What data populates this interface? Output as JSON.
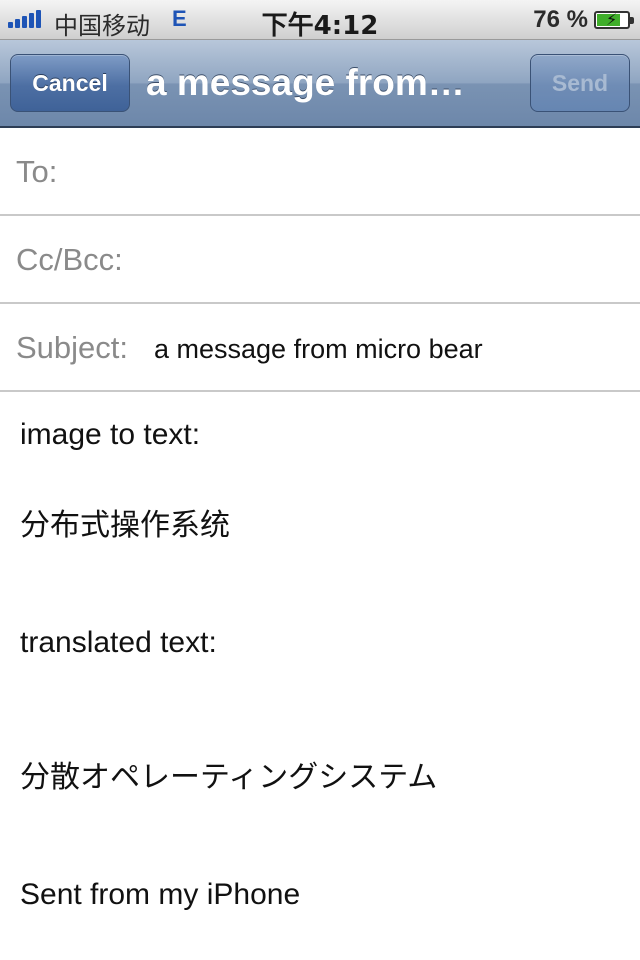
{
  "status_bar": {
    "carrier": "中国移动",
    "network": "E",
    "time": "下午4:12",
    "battery_percent": "76 %",
    "battery_level": 0.76,
    "signal_icon": "signal-bars-icon",
    "battery_icon": "battery-charging-icon"
  },
  "nav": {
    "cancel_label": "Cancel",
    "title": "a message from…",
    "send_label": "Send"
  },
  "fields": {
    "to_label": "To:",
    "cc_label": "Cc/Bcc:",
    "subject_label": "Subject:",
    "subject_value": "a message from micro bear"
  },
  "body": {
    "line1": "image to text:",
    "line2": "分布式操作系统",
    "line3": "translated text:",
    "line4": "分散オペレーティングシステム",
    "line5": "Sent from my iPhone"
  },
  "colors": {
    "nav_bar": "#7a93b3",
    "button": "#4d6fa3",
    "label_gray": "#8a8a8a"
  }
}
